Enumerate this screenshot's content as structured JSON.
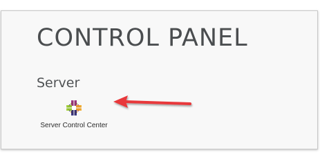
{
  "header": {
    "title": "CONTROL PANEL"
  },
  "section": {
    "title": "Server",
    "apps": [
      {
        "label": "Server Control Center",
        "icon": "centos-logo-icon"
      }
    ]
  },
  "annotation": {
    "type": "arrow",
    "color": "#e8393a"
  },
  "colors": {
    "panel_bg": "#f8f8f8",
    "title": "#4a4d4f",
    "text": "#2b2b2b"
  }
}
